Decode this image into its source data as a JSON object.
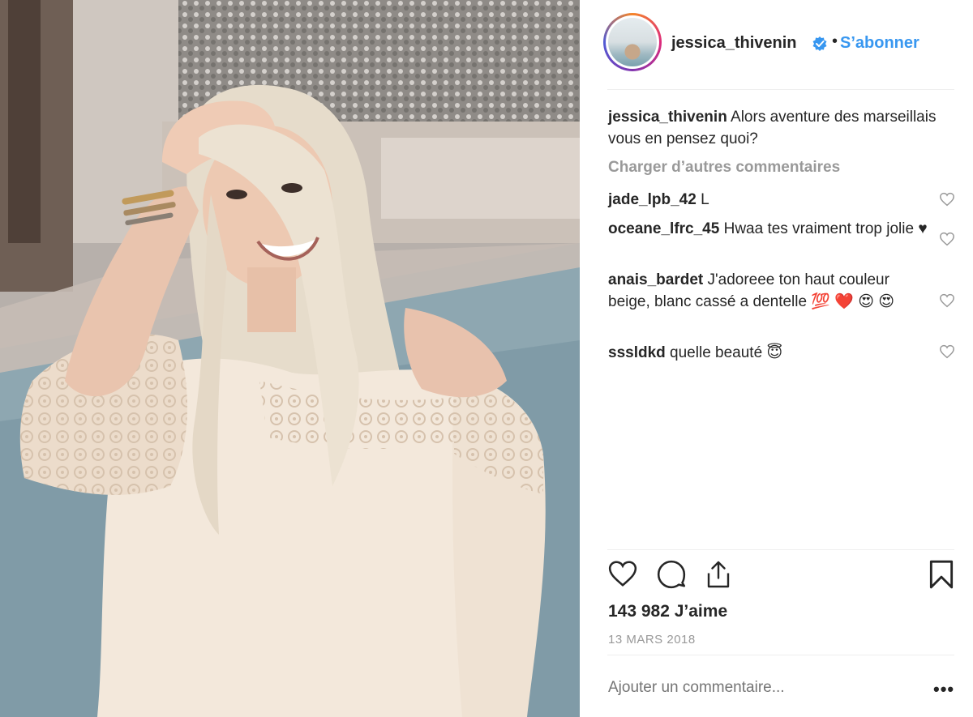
{
  "post": {
    "photo_alt": "photo",
    "author": {
      "username": "jessica_thivenin",
      "verified_icon": "verified-badge-icon",
      "separator": "•",
      "follow_label": "S’abonner"
    },
    "caption": {
      "username": "jessica_thivenin",
      "text": "Alors aventure des marseillais vous en pensez quoi?"
    },
    "load_more_label": "Charger d’autres commentaires",
    "comments": [
      {
        "username": "jade_lpb_42",
        "text": "L"
      },
      {
        "username": "oceane_lfrc_45",
        "text": "Hwaa tes vraiment trop jolie ♥"
      },
      {
        "username": "anais_bardet",
        "text": "J'adoreee ton haut couleur beige, blanc cassé a dentelle 💯 ❤️ 😍 😍"
      },
      {
        "username": "sssldkd",
        "text": "quelle beauté 😇"
      }
    ],
    "likes_label": "143 982 J’aime",
    "date_label": "13 MARS 2018",
    "add_comment_placeholder": "Ajouter un commentaire...",
    "more_label": "•••"
  },
  "colors": {
    "link_blue": "#3897f0",
    "muted_gray": "#999999",
    "text": "#262626"
  }
}
